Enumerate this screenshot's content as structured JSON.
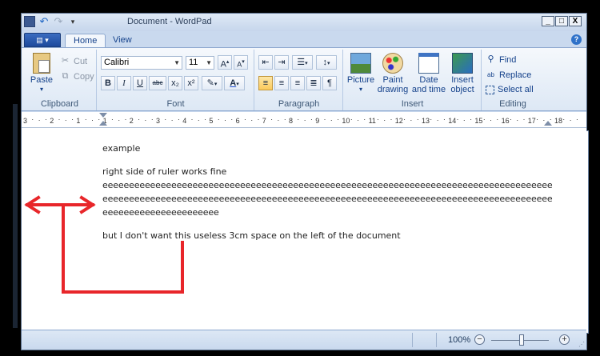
{
  "window": {
    "title": "Document - WordPad",
    "controls": [
      "_",
      "□",
      "X"
    ]
  },
  "app_menu_glyph": "▤ ▾",
  "tabs": [
    "Home",
    "View"
  ],
  "help_glyph": "?",
  "clipboard": {
    "paste": "Paste",
    "cut": "Cut",
    "copy": "Copy",
    "label": "Clipboard"
  },
  "font": {
    "family": "Calibri",
    "size": "11",
    "label": "Font",
    "grow": "A",
    "shrink": "A",
    "bold": "B",
    "italic": "I",
    "underline": "U",
    "strike": "abc",
    "subscript": "x₂",
    "superscript": "x²",
    "highlight": "✎",
    "color": "A"
  },
  "paragraph": {
    "label": "Paragraph"
  },
  "insert": {
    "picture": "Picture",
    "paint": "Paint drawing",
    "datetime": "Date and time",
    "object": "Insert object",
    "label": "Insert"
  },
  "editing": {
    "find": "Find",
    "replace": "Replace",
    "select_all": "Select all",
    "label": "Editing"
  },
  "ruler": {
    "marks": [
      "3",
      "2",
      "1",
      "1",
      "2",
      "3",
      "4",
      "5",
      "6",
      "7",
      "8",
      "9",
      "10",
      "11",
      "12",
      "13",
      "14",
      "15",
      "16",
      "17",
      "18"
    ]
  },
  "document": {
    "line1": "example",
    "line2": "right side of ruler works fine",
    "line3": "eeeeeeeeeeeeeeeeeeeeeeeeeeeeeeeeeeeeeeeeeeeeeeeeeeeeeeeeeeeeeeeeeeeeeeeeeeeeeeeeeeeee",
    "line4": "eeeeeeeeeeeeeeeeeeeeeeeeeeeeeeeeeeeeeeeeeeeeeeeeeeeeeeeeeeeeeeeeeeeeeeeeeeeeeeeeeeeee",
    "line5": "eeeeeeeeeeeeeeeeeeeeee",
    "line6": "but I don't want this useless 3cm space on the left of the document"
  },
  "status": {
    "zoom": "100%",
    "zoom_out": "−",
    "zoom_in": "+"
  },
  "annotation_color": "#e8262a"
}
